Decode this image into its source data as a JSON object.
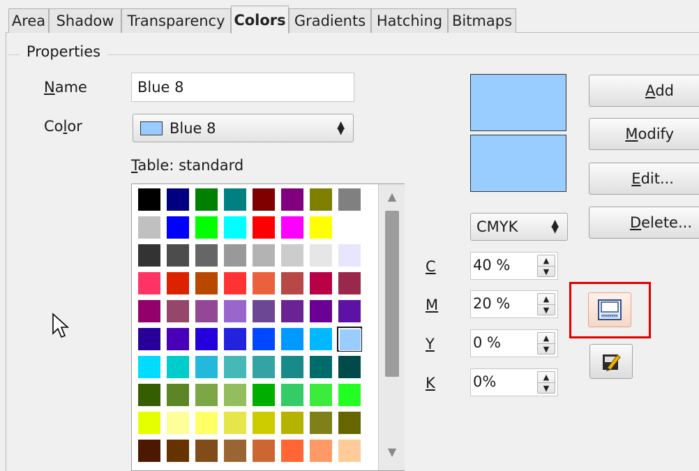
{
  "tabs": [
    {
      "label": "Area"
    },
    {
      "label": "Shadow"
    },
    {
      "label": "Transparency"
    },
    {
      "label": "Colors"
    },
    {
      "label": "Gradients"
    },
    {
      "label": "Hatching"
    },
    {
      "label": "Bitmaps"
    }
  ],
  "active_tab": "Colors",
  "properties": {
    "title": "Properties",
    "name_label_u": "N",
    "name_label_rest": "ame",
    "name_value": "Blue 8",
    "color_label_a": "Co",
    "color_label_u": "l",
    "color_label_b": "or",
    "color_value": "Blue 8",
    "table_label_u": "T",
    "table_label_rest": "able: standard"
  },
  "colors": {
    "selected": "#99ccff",
    "palette": [
      [
        "#000000",
        "#000080",
        "#008000",
        "#008080",
        "#800000",
        "#800080",
        "#808000",
        "#808080"
      ],
      [
        "#c0c0c0",
        "#0000ff",
        "#00ff00",
        "#00ffff",
        "#ff0000",
        "#ff00ff",
        "#ffff00",
        "#ffffff"
      ],
      [
        "#333333",
        "#4c4c4c",
        "#666666",
        "#999999",
        "#b3b3b3",
        "#cccccc",
        "#e6e6e6",
        "#e6e6ff"
      ],
      [
        "#ff3366",
        "#dc2300",
        "#b84700",
        "#ff3333",
        "#eb613d",
        "#b84747",
        "#b80047",
        "#99284c"
      ],
      [
        "#94006b",
        "#94476b",
        "#944794",
        "#9966cc",
        "#6b4794",
        "#6b2394",
        "#6b0094",
        "#5e11a6"
      ],
      [
        "#280099",
        "#4700b8",
        "#2300dc",
        "#2323dc",
        "#0047ff",
        "#0099ff",
        "#00b8ff",
        "#99ccff"
      ],
      [
        "#00dcff",
        "#00cccc",
        "#23b8dc",
        "#47b8b8",
        "#33a3a3",
        "#198a8a",
        "#006b6b",
        "#004a4a"
      ],
      [
        "#355e00",
        "#5c8526",
        "#7da647",
        "#94bd5e",
        "#00ae00",
        "#33cc66",
        "#3deb3d",
        "#23ff23"
      ],
      [
        "#e6ff00",
        "#ffff99",
        "#ffff66",
        "#e6e64c",
        "#cccc00",
        "#b3b300",
        "#808019",
        "#666600"
      ],
      [
        "#4c1900",
        "#663300",
        "#804c19",
        "#996633",
        "#cc6633",
        "#ff6633",
        "#ff9966",
        "#ffcc99"
      ]
    ]
  },
  "buttons": {
    "add_u": "A",
    "add_rest": "dd",
    "modify_u": "M",
    "modify_rest": "odify",
    "edit_u": "E",
    "edit_rest": "dit...",
    "delete_u": "D",
    "delete_rest": "elete..."
  },
  "color_model": "CMYK",
  "cmyk": [
    {
      "label": "C",
      "value": "40 %"
    },
    {
      "label": "M",
      "value": "20 %"
    },
    {
      "label": "Y",
      "value": "0 %"
    },
    {
      "label": "K",
      "value": "0%"
    }
  ],
  "icons": {
    "load": "load-color-list-icon",
    "save": "save-color-list-icon"
  }
}
